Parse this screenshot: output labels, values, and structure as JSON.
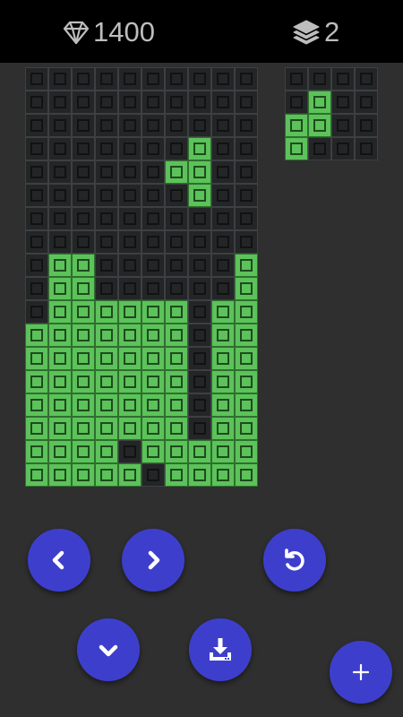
{
  "header": {
    "score_icon": "gem-icon",
    "score": "1400",
    "level_icon": "layers-icon",
    "level": "2"
  },
  "colors": {
    "filled": "#5cc25a",
    "empty": "#232526",
    "button": "#3d3fcc",
    "topbar": "#000000",
    "background": "#2f2f2f"
  },
  "board": {
    "cols": 10,
    "rows": 18,
    "cells": [
      "0000000000",
      "0000000000",
      "0000000000",
      "0000000100",
      "0000001100",
      "0000000100",
      "0000000000",
      "0000000000",
      "0110000001",
      "0110000001",
      "0111111011",
      "1111111011",
      "1111111011",
      "1111111011",
      "1111111011",
      "1111111011",
      "1111011111",
      "1111101111"
    ]
  },
  "next_piece": {
    "cols": 4,
    "rows": 4,
    "cells": [
      "0000",
      "0100",
      "1100",
      "1000"
    ]
  },
  "controls": [
    {
      "name": "move-left-button",
      "icon": "chevron-left-icon"
    },
    {
      "name": "move-right-button",
      "icon": "chevron-right-icon"
    },
    {
      "name": "rotate-button",
      "icon": "rotate-icon"
    },
    {
      "name": "soft-drop-button",
      "icon": "chevron-down-icon"
    },
    {
      "name": "hard-drop-button",
      "icon": "download-icon"
    },
    {
      "name": "add-button",
      "icon": "plus-icon"
    }
  ]
}
